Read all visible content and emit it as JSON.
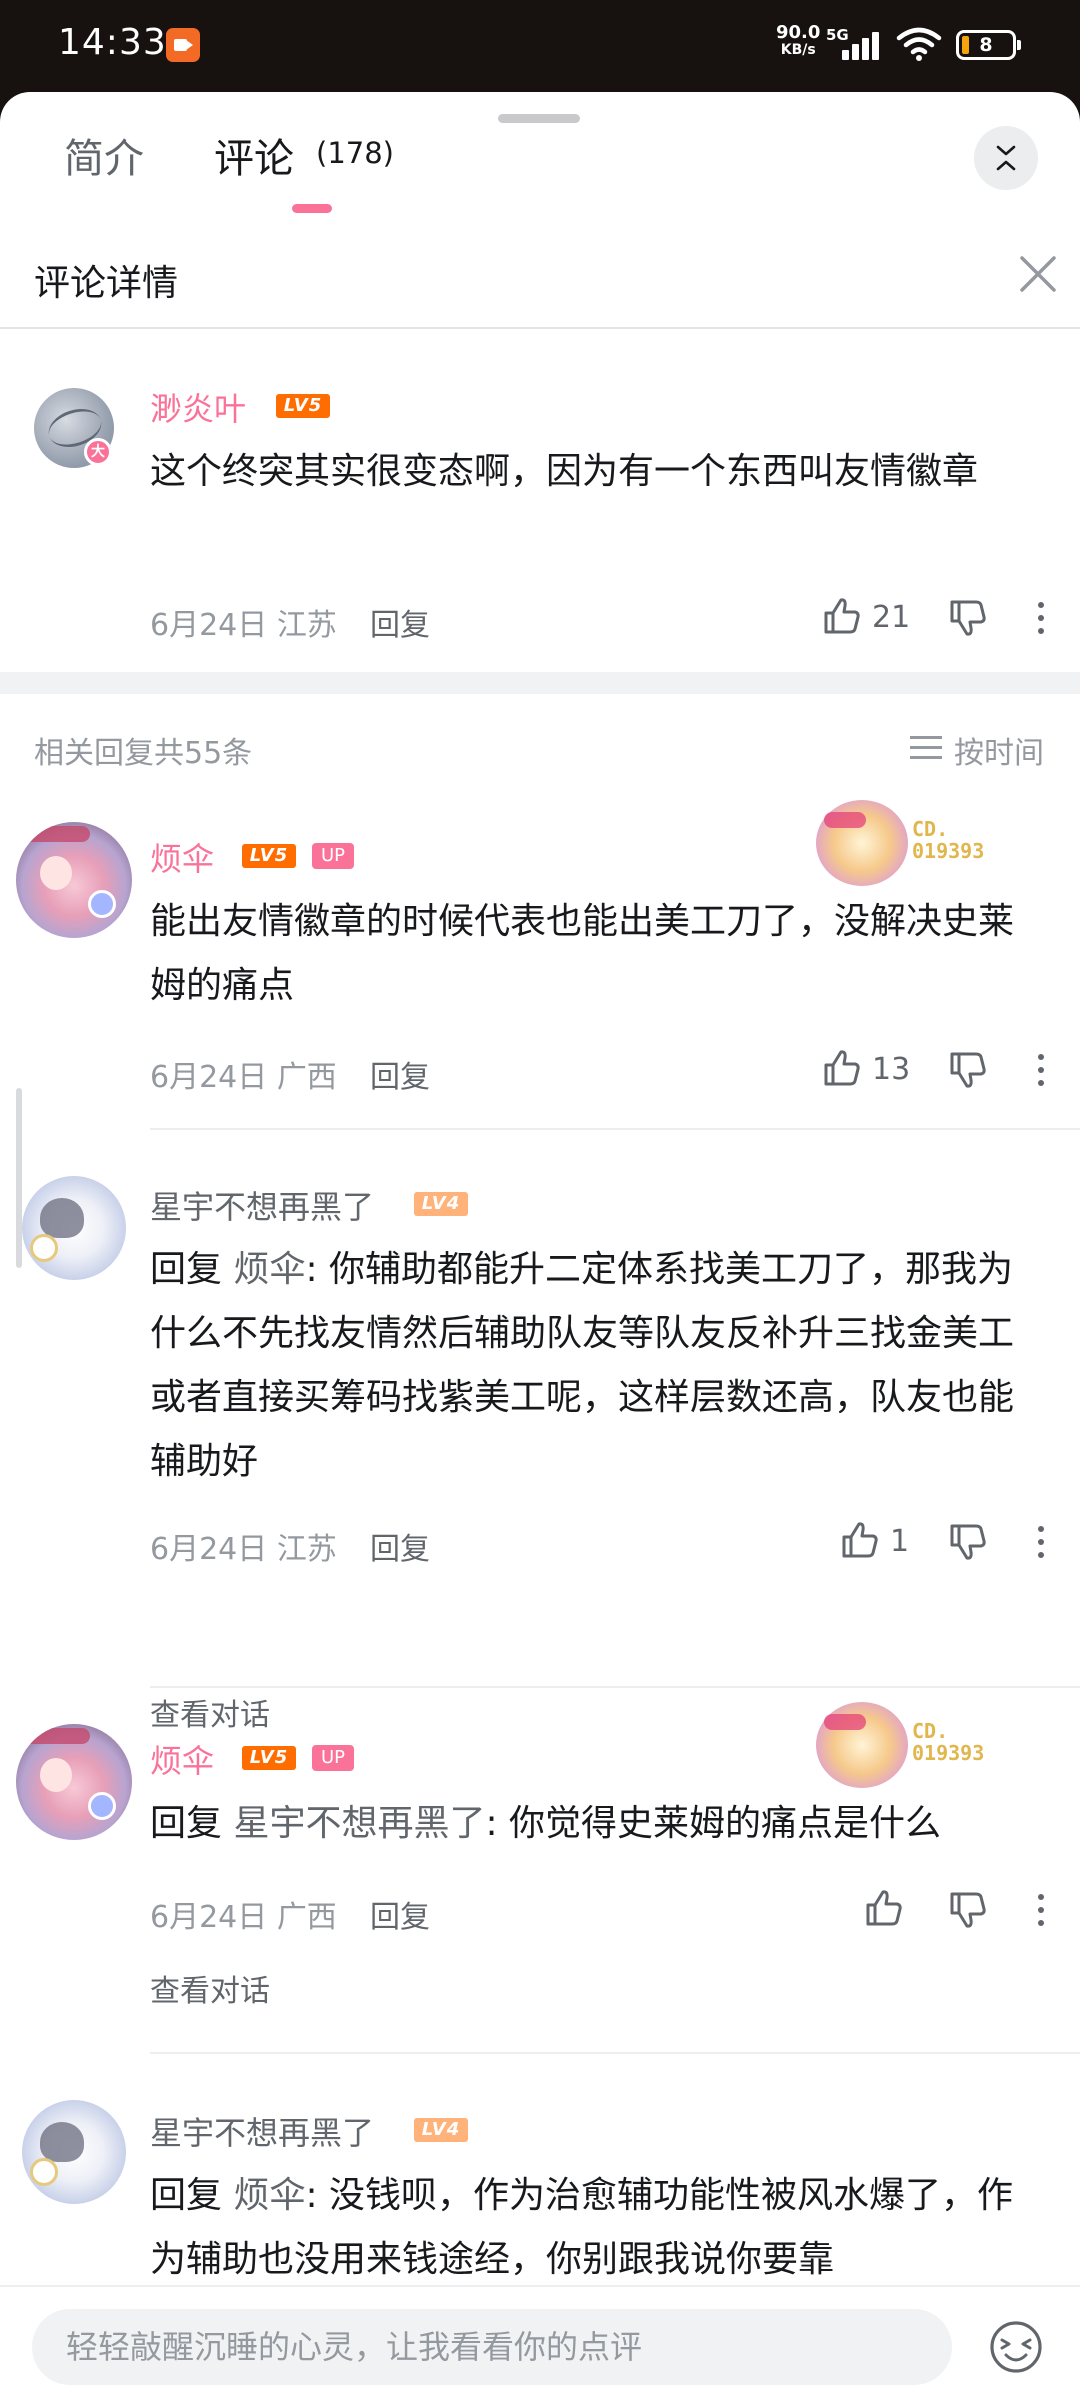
{
  "status_bar": {
    "time": "14:33",
    "net_speed_value": "90.0",
    "net_speed_unit": "KB/s",
    "network": "5G",
    "battery": "8",
    "colors": {
      "recording": "#f36a24",
      "battery_low": "#f4a30f"
    }
  },
  "tabs": {
    "intro_label": "简介",
    "comments_label": "评论",
    "comments_count": "(178)",
    "accent": "#fb7299"
  },
  "detail": {
    "title": "评论详情",
    "icons": {
      "collapse": "double-chevron-icon",
      "close": "close-icon"
    }
  },
  "root_comment": {
    "user": "渺炎叶",
    "level": "LV5",
    "avatar_badge": "大",
    "text": "这个终突其实很变态啊，因为有一个东西叫友情徽章",
    "date": "6月24日",
    "location": "江苏",
    "reply_label": "回复",
    "likes": "21"
  },
  "replies_header": {
    "count_text": "相关回复共55条",
    "sort_label": "按时间"
  },
  "replies": [
    {
      "user": "烦伞",
      "level": "LV5",
      "up_tag": "UP",
      "fan_no": "CD.\n019393",
      "text": "能出友情徽章的时候代表也能出美工刀了，没解决史莱姆的痛点",
      "date": "6月24日",
      "location": "广西",
      "reply_label": "回复",
      "likes": "13"
    },
    {
      "user": "星宇不想再黑了",
      "level": "LV4",
      "reply_prefix": "回复 ",
      "reply_to": "烦伞",
      "text": ": 你辅助都能升二定体系找美工刀了，那我为什么不先找友情然后辅助队友等队友反补升三找金美工或者直接买筹码找紫美工呢，这样层数还高，队友也能辅助好",
      "date": "6月24日",
      "location": "江苏",
      "reply_label": "回复",
      "likes": "1",
      "view_conversation": "查看对话"
    },
    {
      "user": "烦伞",
      "level": "LV5",
      "up_tag": "UP",
      "fan_no": "CD.\n019393",
      "reply_prefix": "回复 ",
      "reply_to": "星宇不想再黑了",
      "text": ": 你觉得史莱姆的痛点是什么",
      "date": "6月24日",
      "location": "广西",
      "reply_label": "回复",
      "view_conversation": "查看对话"
    },
    {
      "user": "星宇不想再黑了",
      "level": "LV4",
      "reply_prefix": "回复 ",
      "reply_to": "烦伞",
      "text": ": 没钱呗，作为治愈辅功能性被风水爆了，作为辅助也没用来钱途经，你别跟我说你要靠"
    }
  ],
  "input_bar": {
    "placeholder": "轻轻敲醒沉睡的心灵，让我看看你的点评",
    "emoji_icon": "emoji-icon"
  }
}
